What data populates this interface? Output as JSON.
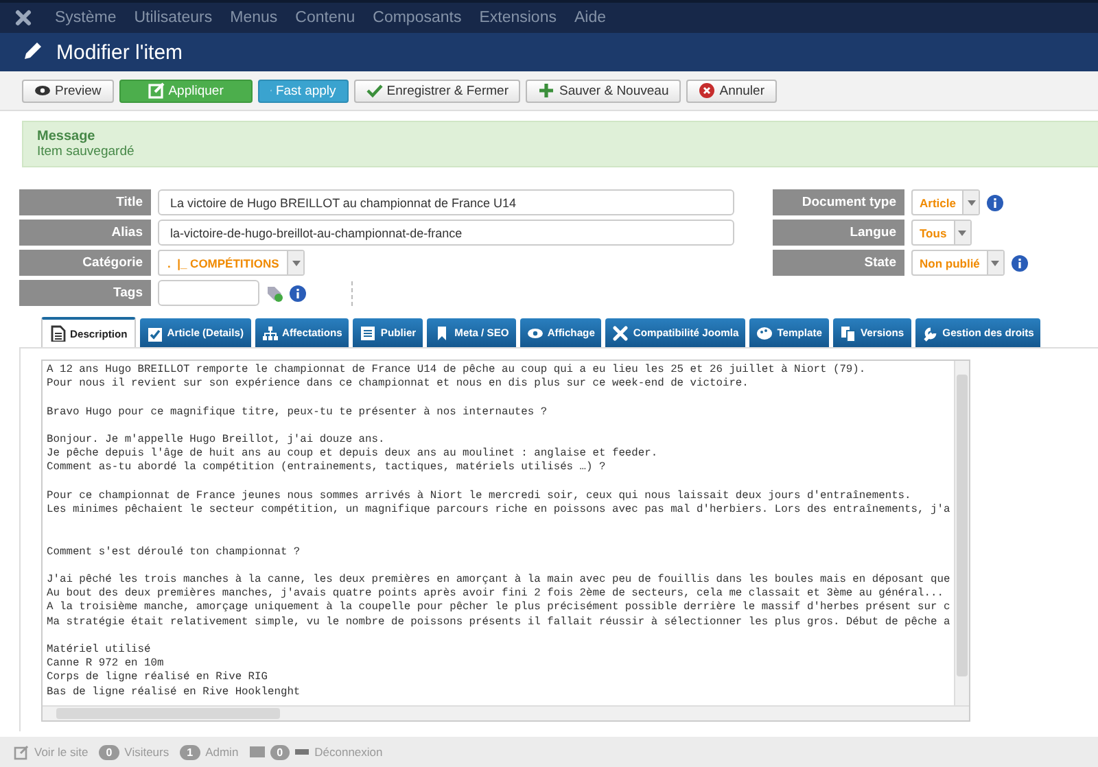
{
  "top_menu": [
    {
      "label": "Système"
    },
    {
      "label": "Utilisateurs"
    },
    {
      "label": "Menus"
    },
    {
      "label": "Contenu"
    },
    {
      "label": "Composants"
    },
    {
      "label": "Extensions"
    },
    {
      "label": "Aide"
    }
  ],
  "header": {
    "title": "Modifier l'item"
  },
  "toolbar": [
    {
      "label": "Preview",
      "kind": "default"
    },
    {
      "label": "Appliquer",
      "kind": "success"
    },
    {
      "label": "Fast apply",
      "kind": "info"
    },
    {
      "label": "Enregistrer & Fermer",
      "kind": "default"
    },
    {
      "label": "Sauver & Nouveau",
      "kind": "default"
    },
    {
      "label": "Annuler",
      "kind": "default"
    }
  ],
  "message": {
    "title": "Message",
    "text": "Item sauvegardé"
  },
  "fields_left": [
    {
      "label": "Title",
      "kind": "text",
      "value": "La victoire de Hugo BREILLOT au championnat de France U14"
    },
    {
      "label": "Alias",
      "kind": "text",
      "value": "la-victoire-de-hugo-breillot-au-championnat-de-france"
    },
    {
      "label": "Catégorie",
      "kind": "select",
      "value": ".  |_ COMPÉTITIONS"
    },
    {
      "label": "Tags",
      "kind": "tags"
    }
  ],
  "fields_right": [
    {
      "label": "Document type",
      "value": "Article",
      "info": true
    },
    {
      "label": "Langue",
      "value": "Tous",
      "info": false
    },
    {
      "label": "State",
      "value": "Non publié",
      "info": true
    }
  ],
  "tabs": [
    {
      "label": "Description",
      "selected": true
    },
    {
      "label": "Article (Details)",
      "selected": false
    },
    {
      "label": "Affectations",
      "selected": false
    },
    {
      "label": "Publier",
      "selected": false
    },
    {
      "label": "Meta / SEO",
      "selected": false
    },
    {
      "label": "Affichage",
      "selected": false
    },
    {
      "label": "Compatibilité Joomla",
      "selected": false
    },
    {
      "label": "Template",
      "selected": false
    },
    {
      "label": "Versions",
      "selected": false
    },
    {
      "label": "Gestion des droits",
      "selected": false
    }
  ],
  "editor": {
    "content": "A 12 ans Hugo BREILLOT remporte le championnat de France U14 de pêche au coup qui a eu lieu les 25 et 26 juillet à Niort (79).\nPour nous il revient sur son expérience dans ce championnat et nous en dis plus sur ce week-end de victoire.\n\nBravo Hugo pour ce magnifique titre, peux-tu te présenter à nos internautes ?\n\nBonjour. Je m'appelle Hugo Breillot, j'ai douze ans.\nJe pêche depuis l'âge de huit ans au coup et depuis deux ans au moulinet : anglaise et feeder.\nComment as-tu abordé la compétition (entrainements, tactiques, matériels utilisés …) ?\n\nPour ce championnat de France jeunes nous sommes arrivés à Niort le mercredi soir, ceux qui nous laissait deux jours d'entraînements.\nLes minimes pêchaient le secteur compétition, un magnifique parcours riche en poissons avec pas mal d'herbiers. Lors des entraînements, j'a\n\n\nComment s'est déroulé ton championnat ?\n\nJ'ai pêché les trois manches à la canne, les deux premières en amorçant à la main avec peu de fouillis dans les boules mais en déposant que\nAu bout des deux premières manches, j'avais quatre points après avoir fini 2 fois 2ème de secteurs, cela me classait et 3ème au général...\nA la troisième manche, amorçage uniquement à la coupelle pour pêcher le plus précisément possible derrière le massif d'herbes présent sur c\nMa stratégie était relativement simple, vu le nombre de poissons présents il fallait réussir à sélectionner les plus gros. Début de pêche a\n\nMatériel utilisé\nCanne R 972 en 10m\nCorps de ligne réalisé en Rive RIG\nBas de ligne réalisé en Rive Hooklenght"
  },
  "status_bar": {
    "view_site": "Voir le site",
    "visitors_count": "0",
    "visitors": "Visiteurs",
    "admin_count": "1",
    "admin": "Admin",
    "messages_count": "0",
    "logout": "Déconnexion"
  }
}
